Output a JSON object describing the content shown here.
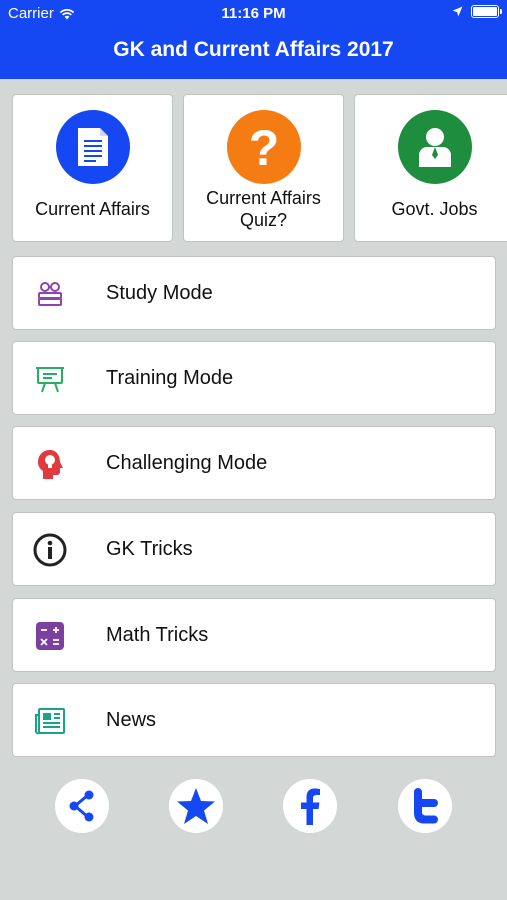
{
  "status_bar": {
    "carrier": "Carrier",
    "time": "11:16 PM"
  },
  "header": {
    "title": "GK and Current Affairs 2017"
  },
  "tiles": [
    {
      "label": "Current Affairs",
      "icon": "document-icon",
      "color": "#1547f2"
    },
    {
      "label": "Current Affairs Quiz?",
      "icon": "question-icon",
      "color": "#f57c12"
    },
    {
      "label": "Govt. Jobs",
      "icon": "person-icon",
      "color": "#1e8e3e"
    }
  ],
  "menu": [
    {
      "label": "Study Mode",
      "icon": "glasses-books-icon",
      "color": "#8e44ad"
    },
    {
      "label": "Training Mode",
      "icon": "presentation-board-icon",
      "color": "#27ae60"
    },
    {
      "label": "Challenging Mode",
      "icon": "head-bulb-icon",
      "color": "#e03a3e"
    },
    {
      "label": "GK Tricks",
      "icon": "info-icon",
      "color": "#222222"
    },
    {
      "label": "Math Tricks",
      "icon": "calculator-icon",
      "color": "#7b3fa0"
    },
    {
      "label": "News",
      "icon": "newspaper-icon",
      "color": "#1aa38a"
    }
  ],
  "social": [
    {
      "icon": "share-icon"
    },
    {
      "icon": "star-icon"
    },
    {
      "icon": "facebook-icon"
    },
    {
      "icon": "twitter-icon"
    }
  ],
  "colors": {
    "primary": "#1547f2",
    "background": "#d3d7d6"
  }
}
